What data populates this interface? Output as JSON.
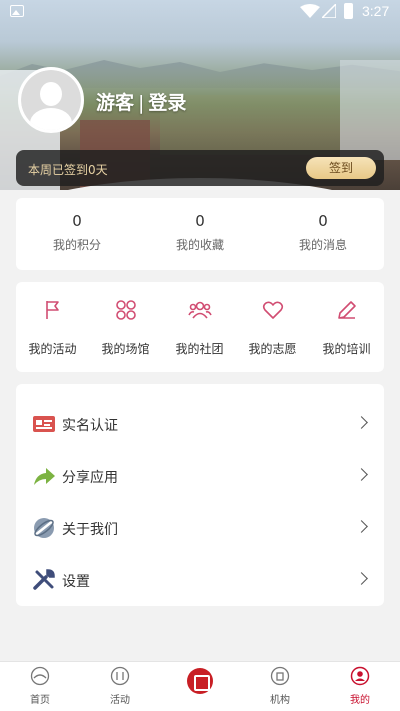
{
  "statusbar": {
    "time": "3:27"
  },
  "profile": {
    "guest_label": "游客",
    "separator": "|",
    "login_label": "登录"
  },
  "signin": {
    "text": "本周已签到0天",
    "button_label": "签到"
  },
  "stats": [
    {
      "value": "0",
      "label": "我的积分"
    },
    {
      "value": "0",
      "label": "我的收藏"
    },
    {
      "value": "0",
      "label": "我的消息"
    }
  ],
  "quick_actions": [
    {
      "label": "我的活动",
      "icon": "flag-icon"
    },
    {
      "label": "我的场馆",
      "icon": "venue-icon"
    },
    {
      "label": "我的社团",
      "icon": "group-icon"
    },
    {
      "label": "我的志愿",
      "icon": "heart-icon"
    },
    {
      "label": "我的培训",
      "icon": "pencil-icon"
    }
  ],
  "menu": [
    {
      "label": "实名认证",
      "icon": "id-card-icon"
    },
    {
      "label": "分享应用",
      "icon": "share-icon"
    },
    {
      "label": "关于我们",
      "icon": "about-icon"
    },
    {
      "label": "设置",
      "icon": "tools-icon"
    }
  ],
  "bottom_nav": [
    {
      "label": "首页",
      "icon": "home-icon"
    },
    {
      "label": "活动",
      "icon": "activity-icon"
    },
    {
      "label": "",
      "icon": "center-app-icon"
    },
    {
      "label": "机构",
      "icon": "institution-icon"
    },
    {
      "label": "我的",
      "icon": "profile-icon",
      "active": true
    }
  ],
  "colors": {
    "accent": "#c8102e",
    "icon_pink": "#d14d72",
    "sign_gold": "#e8c887"
  }
}
